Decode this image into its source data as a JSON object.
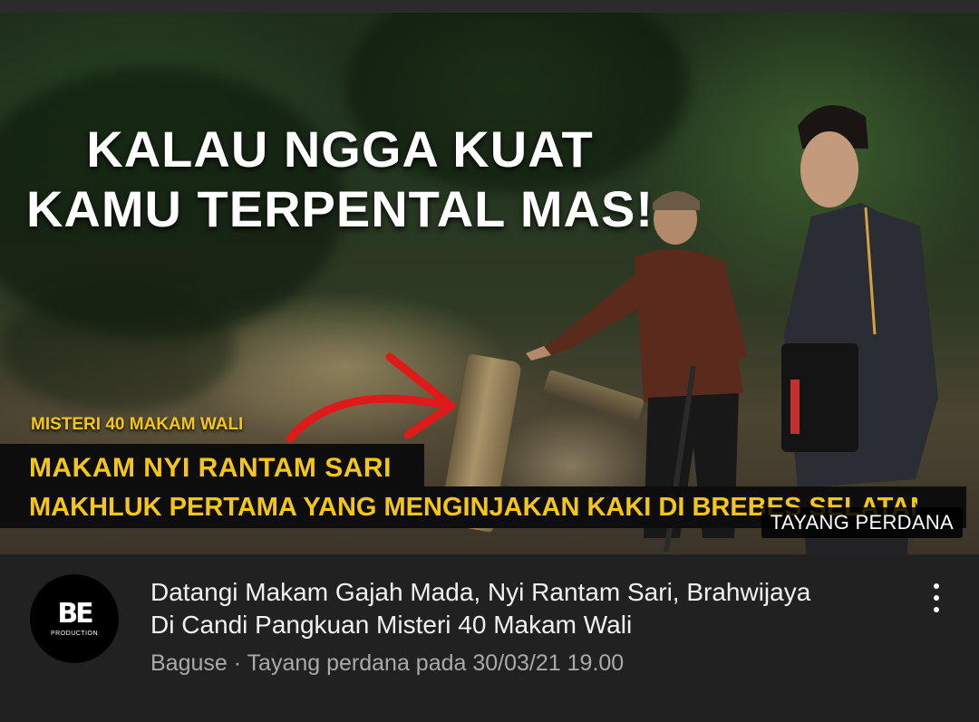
{
  "thumbnail": {
    "headline_line1": "KALAU NGGA KUAT",
    "headline_line2": "KAMU TERPENTAL MAS!",
    "series_label": "MISTERI 40 MAKAM WALI",
    "banner_line1": "MAKAM NYI RANTAM SARI",
    "banner_line2": "MAKHLUK PERTAMA YANG MENGINJAKAN KAKI DI BREBES SELATAN",
    "badge": "TAYANG PERDANA",
    "colors": {
      "caption_yellow": "#f5c518",
      "arrow_red": "#e0191b"
    }
  },
  "channel": {
    "avatar_logo": "BE",
    "avatar_sub": "PRODUCTION",
    "name": "Baguse"
  },
  "video": {
    "title": "Datangi Makam Gajah Mada, Nyi Rantam Sari, Brahwijaya\nDi Candi Pangkuan  Misteri 40 Makam Wali",
    "meta": "Baguse · Tayang perdana pada 30/03/21 19.00"
  },
  "icons": {
    "menu": "more-vertical-icon"
  }
}
